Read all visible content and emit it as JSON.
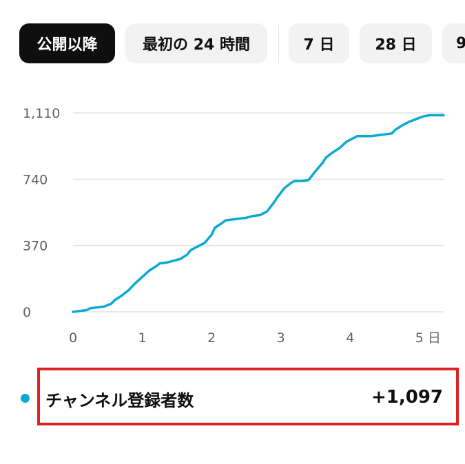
{
  "filters": {
    "chips": [
      {
        "label": "公開以降",
        "active": true
      },
      {
        "label": "最初の 24 時間",
        "active": false
      },
      {
        "label": "7 日",
        "active": false
      },
      {
        "label": "28 日",
        "active": false
      },
      {
        "label": "9",
        "active": false
      }
    ]
  },
  "colors": {
    "series": "#0aa9d0",
    "grid": "#e2e2e2",
    "axis_text": "#606060",
    "highlight_box": "#e02020"
  },
  "chart_data": {
    "type": "line",
    "title": "",
    "xlabel": "",
    "ylabel": "",
    "x_ticks": [
      {
        "value": 0,
        "label": "0"
      },
      {
        "value": 1,
        "label": "1"
      },
      {
        "value": 2,
        "label": "2"
      },
      {
        "value": 3,
        "label": "3"
      },
      {
        "value": 4,
        "label": "4"
      },
      {
        "value": 5,
        "label": "5 日"
      }
    ],
    "y_ticks": [
      {
        "value": 0,
        "label": "0"
      },
      {
        "value": 370,
        "label": "370"
      },
      {
        "value": 740,
        "label": "740"
      },
      {
        "value": 1110,
        "label": "1,110"
      }
    ],
    "xlim": [
      0,
      5.35
    ],
    "ylim": [
      0,
      1110
    ],
    "grid": true,
    "series": [
      {
        "name": "チャンネル登録者数",
        "x": [
          0,
          0.1,
          0.2,
          0.25,
          0.35,
          0.45,
          0.55,
          0.6,
          0.7,
          0.8,
          0.9,
          1.0,
          1.1,
          1.2,
          1.25,
          1.35,
          1.45,
          1.55,
          1.65,
          1.7,
          1.8,
          1.9,
          2.0,
          2.05,
          2.15,
          2.2,
          2.3,
          2.4,
          2.5,
          2.6,
          2.7,
          2.8,
          2.9,
          2.95,
          3.05,
          3.15,
          3.2,
          3.3,
          3.4,
          3.5,
          3.6,
          3.65,
          3.75,
          3.85,
          3.95,
          4.05,
          4.1,
          4.2,
          4.3,
          4.4,
          4.5,
          4.6,
          4.65,
          4.75,
          4.85,
          4.95,
          5.05,
          5.15,
          5.25,
          5.35
        ],
        "y": [
          0,
          5,
          10,
          20,
          25,
          30,
          45,
          65,
          90,
          120,
          160,
          195,
          230,
          255,
          270,
          275,
          285,
          295,
          320,
          345,
          365,
          385,
          430,
          470,
          495,
          510,
          515,
          520,
          525,
          535,
          540,
          560,
          610,
          640,
          690,
          720,
          730,
          730,
          735,
          785,
          830,
          860,
          890,
          915,
          950,
          970,
          980,
          980,
          980,
          985,
          990,
          995,
          1015,
          1040,
          1060,
          1075,
          1090,
          1097,
          1097,
          1097
        ]
      }
    ]
  },
  "legend": {
    "label": "チャンネル登録者数",
    "value": "+1,097"
  }
}
